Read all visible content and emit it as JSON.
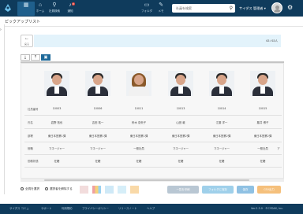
{
  "nav": {
    "items": [
      {
        "label": "",
        "icon": "apps-grid-icon"
      },
      {
        "label": "ホーム",
        "icon": "home-icon"
      },
      {
        "label": "社員検索",
        "icon": "user-search-icon"
      },
      {
        "label": "通知",
        "icon": "bell-icon",
        "badge": "8"
      },
      {
        "label": "フォルダ",
        "icon": "folder-icon"
      },
      {
        "label": "メモ",
        "icon": "memo-icon"
      }
    ],
    "search_placeholder": "社員を検索",
    "user_name": "サイダス 管理者 ▾"
  },
  "page": {
    "title": "ピックアップリスト",
    "back_label": "戻る",
    "count": "63 / 63人"
  },
  "table": {
    "row_labels": [
      "社員番号",
      "氏名",
      "部署",
      "役職",
      "勤務状態"
    ],
    "employees": [
      {
        "id": "10003",
        "name": "岩野 拓也",
        "dept": "東日本営業1課",
        "role": "マネージャー",
        "status": "在籍",
        "photo": "male"
      },
      {
        "id": "10006",
        "name": "吉田 祐一",
        "dept": "東日本営業1課",
        "role": "マネージャー",
        "status": "在籍",
        "photo": "male"
      },
      {
        "id": "10011",
        "name": "鈴木 奈央子",
        "dept": "東日本営業1課",
        "role": "一般社員",
        "status": "在籍",
        "photo": "female"
      },
      {
        "id": "10013",
        "name": "山田 敦",
        "dept": "東日本営業2課",
        "role": "マネージャー",
        "status": "在籍",
        "photo": "male"
      },
      {
        "id": "10014",
        "name": "江藤 洋一",
        "dept": "東日本営業2課",
        "role": "マネージャー",
        "status": "在籍",
        "photo": "male"
      },
      {
        "id": "10015",
        "name": "藤井 博子",
        "dept": "東日本営業2課",
        "role": "一般社員",
        "status": "在籍",
        "photo": "male"
      }
    ],
    "overflow_role": "ア"
  },
  "bottom": {
    "select_all": "全員を選択",
    "select_individual": "選択者を解除する",
    "actions": [
      {
        "label": "一覧を印刷",
        "color": "#b9c7d3"
      },
      {
        "label": "フォルダに保存",
        "color": "#9fd0ea"
      },
      {
        "label": "保存",
        "color": "#8fc1e3"
      },
      {
        "label": "CSV出力",
        "color": "#f5c07c"
      }
    ]
  },
  "footer": [
    "サイダス コミュ",
    "サポート",
    "利用規約",
    "プライバシーポリシー",
    "リリースノート",
    "ヘルプ",
    "Ver.2.3.0 · ©CYDAS, Inc."
  ],
  "colors": {
    "topbar": "#0f3b5c",
    "accent": "#1f6a9a",
    "pager": "#e3f3fb"
  }
}
